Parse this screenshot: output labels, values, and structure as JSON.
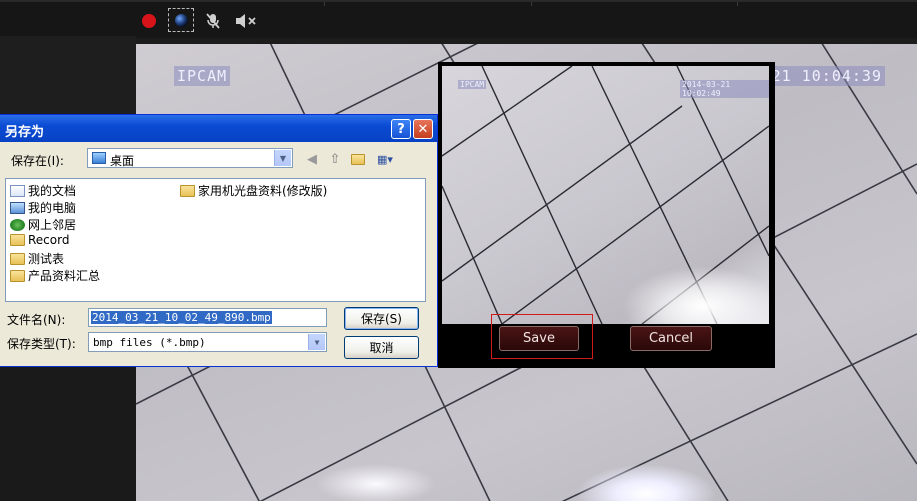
{
  "toolbar": {
    "icons": [
      "record-icon",
      "camera-snapshot-icon",
      "mic-muted-icon",
      "speaker-muted-icon"
    ]
  },
  "video": {
    "osd_camera": "IPCAM",
    "osd_time": "21 10:04:39"
  },
  "preview": {
    "osd_camera": "IPCAM",
    "osd_time": "2014-03-21 10:02:49",
    "save_label": "Save",
    "cancel_label": "Cancel"
  },
  "dialog": {
    "title": "另存为",
    "help_glyph": "?",
    "close_glyph": "✕",
    "save_in_label": "保存在(I):",
    "save_in_value": "桌面",
    "items": [
      {
        "name": "我的文档",
        "icon": "my-documents-icon"
      },
      {
        "name": "我的电脑",
        "icon": "my-computer-icon"
      },
      {
        "name": "网上邻居",
        "icon": "network-places-icon"
      },
      {
        "name": "Record",
        "icon": "folder-icon"
      },
      {
        "name": "测试表",
        "icon": "folder-icon"
      },
      {
        "name": "产品资料汇总",
        "icon": "folder-icon"
      },
      {
        "name": "家用机光盘资料(修改版)",
        "icon": "folder-icon"
      }
    ],
    "filename_label": "文件名(N):",
    "filename_value": "2014_03_21_10_02_49_890.bmp",
    "filetype_label": "保存类型(T):",
    "filetype_value": "bmp files (*.bmp)",
    "save_button": "保存(S)",
    "cancel_button": "取消"
  }
}
